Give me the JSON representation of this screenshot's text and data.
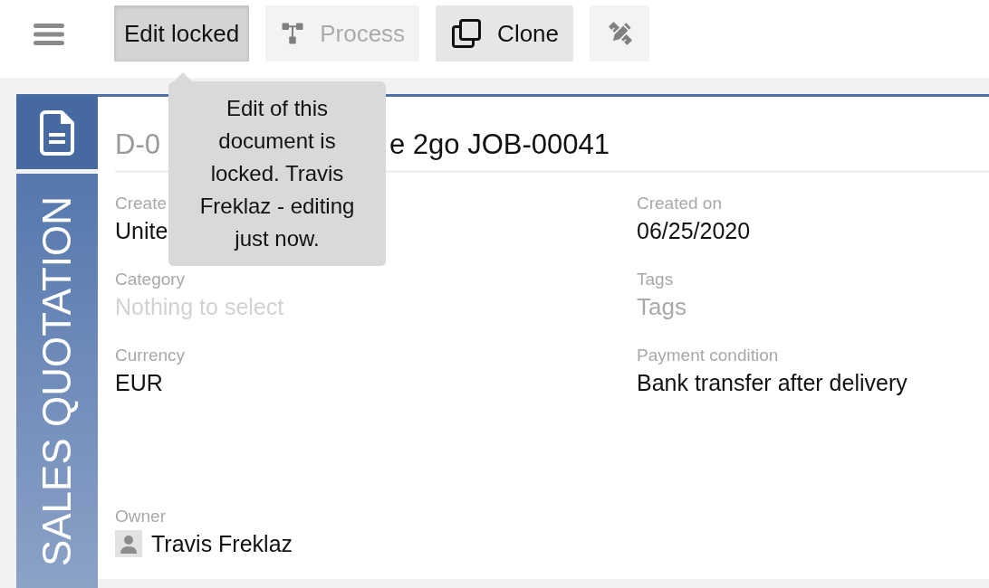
{
  "toolbar": {
    "buttons": [
      {
        "label": "Edit locked",
        "pressed": true,
        "disabled": false
      },
      {
        "label": "Process",
        "pressed": false,
        "disabled": true
      },
      {
        "label": "Clone",
        "pressed": false,
        "disabled": false
      },
      {
        "pressed": false,
        "disabled": true
      }
    ]
  },
  "tooltip": {
    "text": "Edit of this document is locked. Travis Freklaz - editing just now."
  },
  "sidebar": {
    "title": "SALES QUOTATION"
  },
  "document": {
    "number": "D-0",
    "title": "e 2go JOB-00041",
    "fields": [
      {
        "kind": "text",
        "label": "Create",
        "value": "Unite"
      },
      {
        "kind": "text",
        "label": "Created on",
        "value": "06/25/2020"
      },
      {
        "kind": "select",
        "label": "Category",
        "placeholder": "Nothing to select"
      },
      {
        "kind": "tags",
        "label": "Tags",
        "placeholder": "Tags"
      },
      {
        "kind": "text",
        "label": "Currency",
        "value": "EUR"
      },
      {
        "kind": "text",
        "label": "Payment condition",
        "value": "Bank transfer after delivery"
      }
    ],
    "owner": {
      "label": "Owner",
      "name": "Travis Freklaz"
    }
  }
}
